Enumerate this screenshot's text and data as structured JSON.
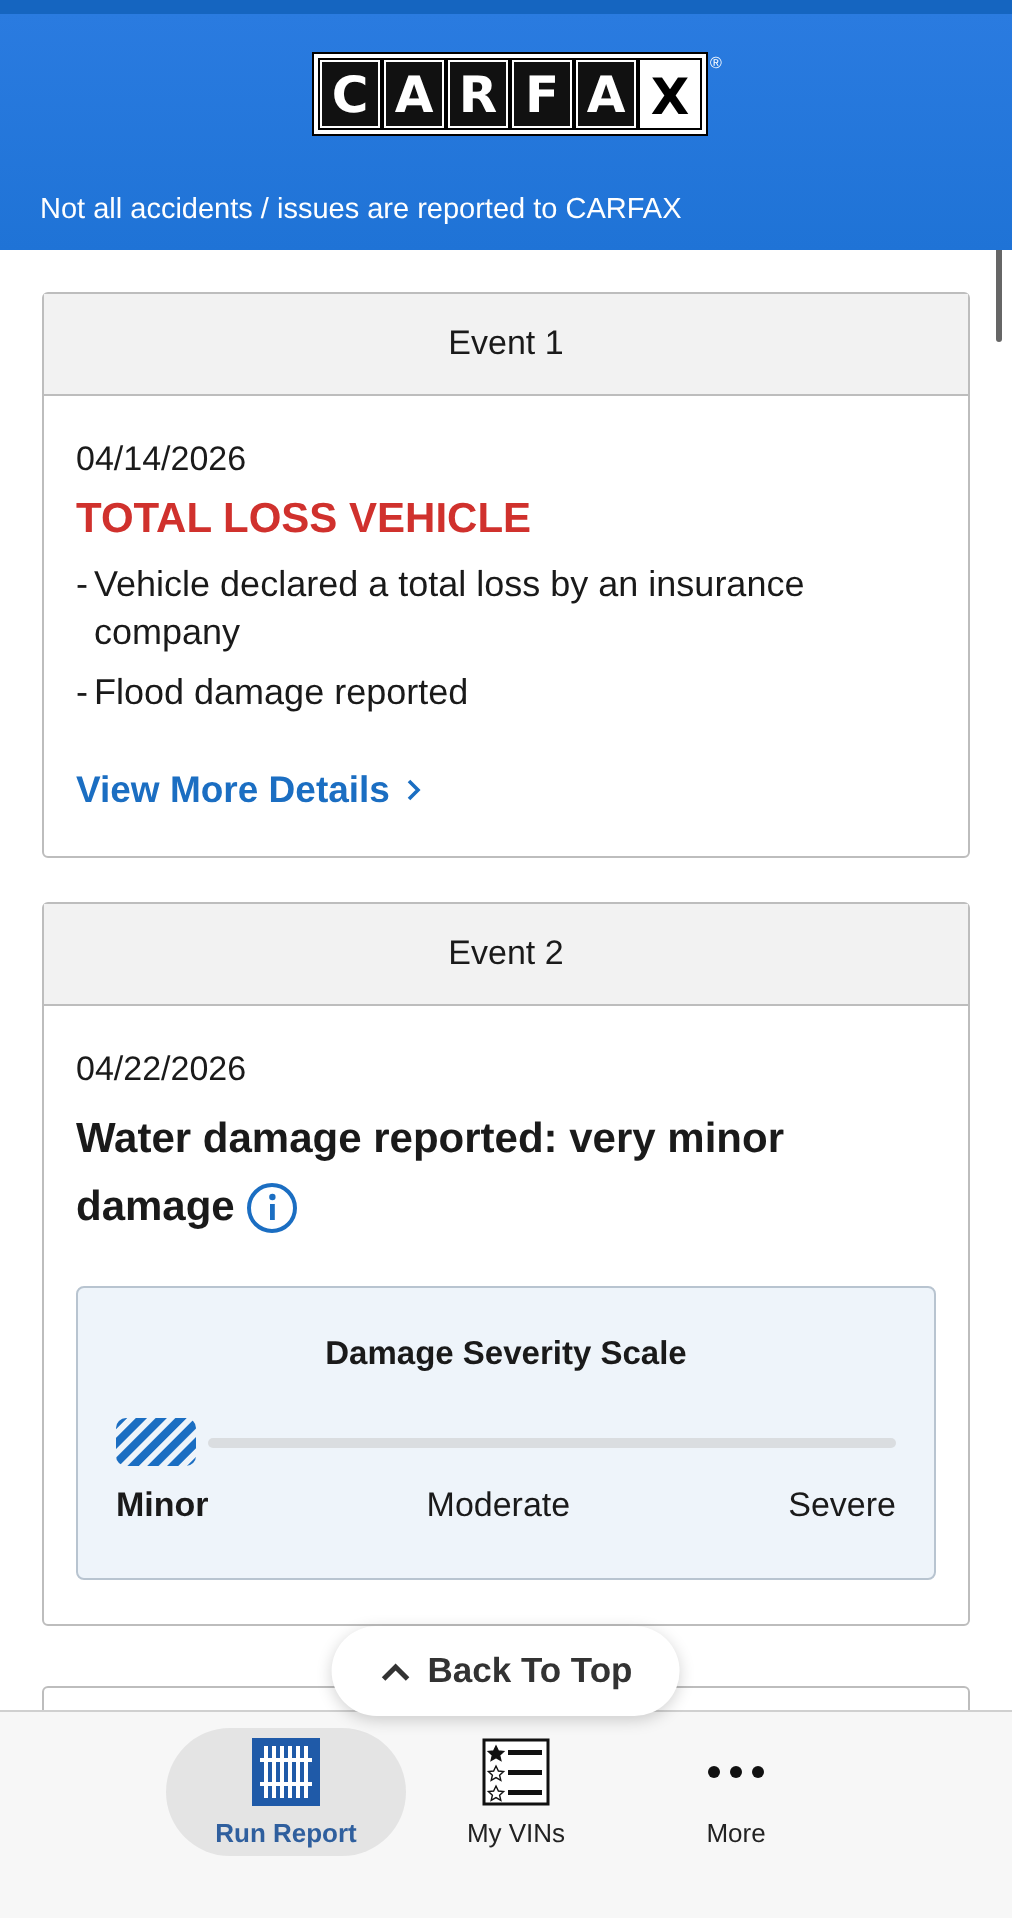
{
  "header": {
    "logo_letters": [
      "C",
      "A",
      "R",
      "F",
      "A",
      "X"
    ],
    "logo_mark": "®",
    "notice": "Not all accidents / issues are reported to CARFAX"
  },
  "events": [
    {
      "title": "Event 1",
      "date": "04/14/2026",
      "headline": "TOTAL LOSS VEHICLE",
      "kind": "alert",
      "bullets": [
        {
          "marker": "-",
          "text": "Vehicle declared a total loss by an insurance company"
        },
        {
          "marker": "-",
          "text": "Flood damage reported"
        }
      ],
      "link": "View More Details"
    },
    {
      "title": "Event 2",
      "date": "04/22/2026",
      "headline": "Water damage reported: very minor damage",
      "kind": "damage",
      "scale": {
        "title": "Damage Severity Scale",
        "levels": [
          {
            "label": "Minor",
            "selected": true
          },
          {
            "label": "Moderate",
            "selected": false
          },
          {
            "label": "Severe",
            "selected": false
          }
        ]
      }
    }
  ],
  "back_to_top": "Back To Top",
  "nav": [
    {
      "label": "Run Report",
      "kind": "report",
      "selected": true
    },
    {
      "label": "My VINs",
      "kind": "vins",
      "selected": false
    },
    {
      "label": "More",
      "kind": "more",
      "selected": false
    }
  ]
}
